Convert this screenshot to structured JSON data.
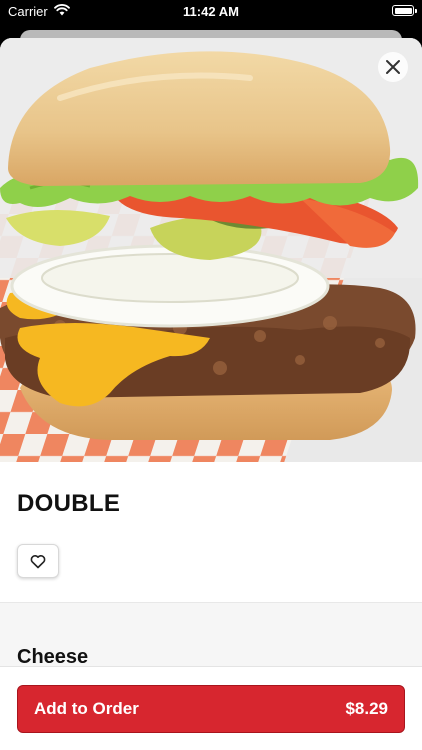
{
  "status_bar": {
    "carrier": "Carrier",
    "time": "11:42 AM",
    "icons": [
      "wifi-icon",
      "battery-icon"
    ]
  },
  "item": {
    "name": "DOUBLE",
    "image": "burger-photo"
  },
  "section": {
    "title": "Cheese"
  },
  "footer": {
    "add_label": "Add to Order",
    "price": "$8.29"
  },
  "colors": {
    "accent": "#d7262f"
  }
}
